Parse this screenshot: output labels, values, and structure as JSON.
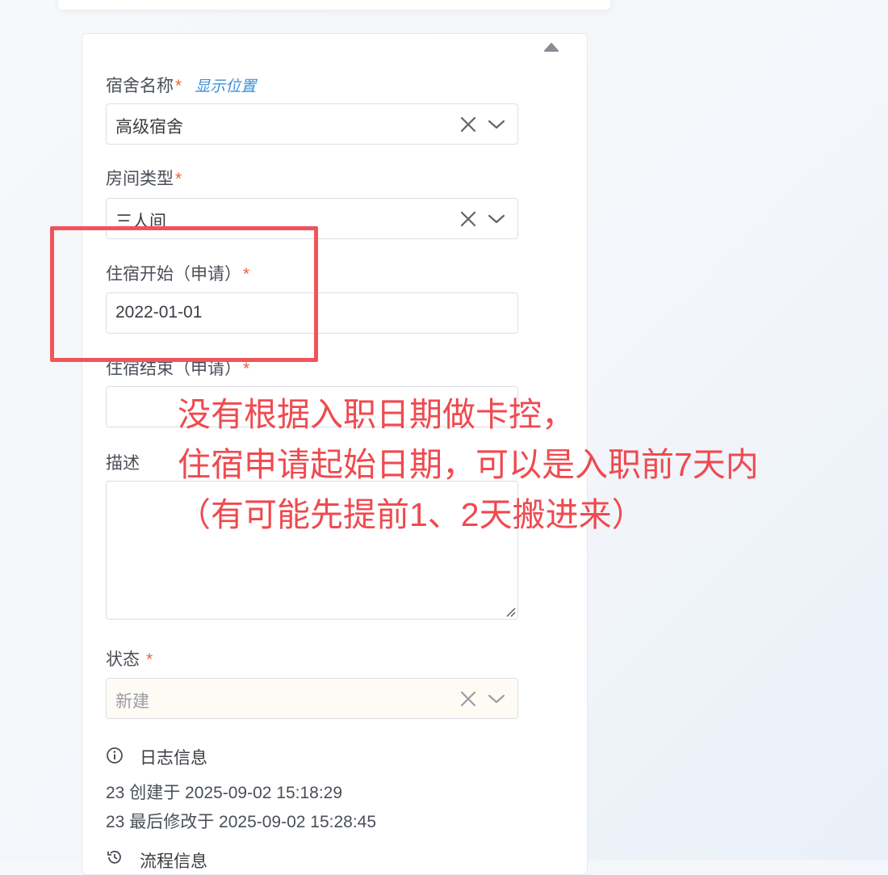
{
  "form": {
    "dorm_name": {
      "label": "宿舍名称",
      "required_mark": "*",
      "link": "显示位置",
      "value": "高级宿舍"
    },
    "room_type": {
      "label": "房间类型",
      "required_mark": "*",
      "value": "三人间"
    },
    "stay_start": {
      "label": "住宿开始（申请）",
      "required_mark": "*",
      "value": "2022-01-01"
    },
    "stay_end": {
      "label": "住宿结束（申请）",
      "required_mark": "*",
      "value": ""
    },
    "description": {
      "label": "描述",
      "value": ""
    },
    "status": {
      "label": "状态",
      "required_mark": "*",
      "value": "新建"
    }
  },
  "log": {
    "title": "日志信息",
    "created": "23 创建于 2025-09-02 15:18:29",
    "modified": "23 最后修改于 2025-09-02 15:28:45"
  },
  "flow": {
    "title": "流程信息"
  },
  "annotation": {
    "line1": "没有根据入职日期做卡控，",
    "line2": "住宿申请起始日期，可以是入职前7天内",
    "line3": "（有可能先提前1、2天搬进来）"
  },
  "colors": {
    "required": "#e8663a",
    "link": "#3b8fd9",
    "annotation": "#ef4a4f",
    "border": "#dcdfe6"
  }
}
